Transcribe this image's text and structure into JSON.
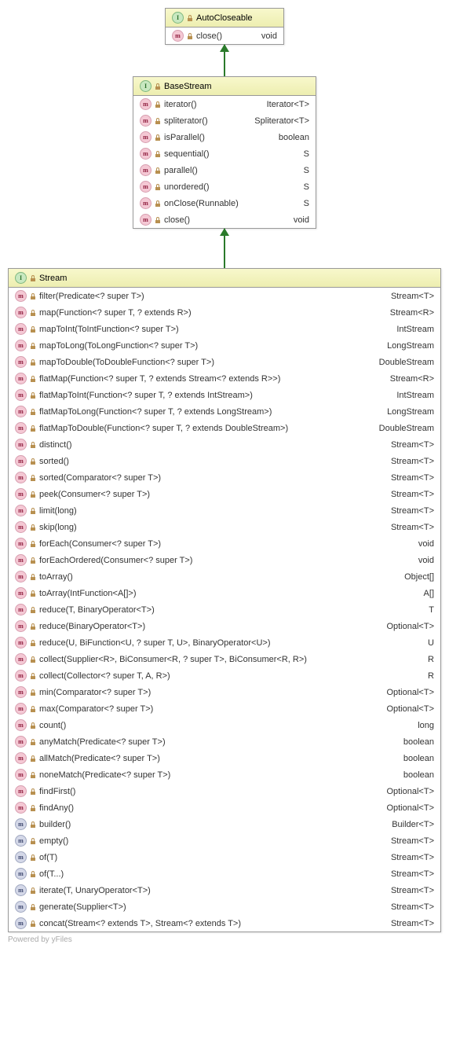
{
  "classes": {
    "autocloseable": {
      "name": "AutoCloseable",
      "members": [
        {
          "kind": "m",
          "name": "close()",
          "ret": "void"
        }
      ]
    },
    "basestream": {
      "name": "BaseStream",
      "members": [
        {
          "kind": "m",
          "name": "iterator()",
          "ret": "Iterator<T>"
        },
        {
          "kind": "m",
          "name": "spliterator()",
          "ret": "Spliterator<T>"
        },
        {
          "kind": "m",
          "name": "isParallel()",
          "ret": "boolean"
        },
        {
          "kind": "m",
          "name": "sequential()",
          "ret": "S"
        },
        {
          "kind": "m",
          "name": "parallel()",
          "ret": "S"
        },
        {
          "kind": "m",
          "name": "unordered()",
          "ret": "S"
        },
        {
          "kind": "m",
          "name": "onClose(Runnable)",
          "ret": "S"
        },
        {
          "kind": "m",
          "name": "close()",
          "ret": "void"
        }
      ]
    },
    "stream": {
      "name": "Stream",
      "members": [
        {
          "kind": "m",
          "name": "filter(Predicate<? super T>)",
          "ret": "Stream<T>"
        },
        {
          "kind": "m",
          "name": "map(Function<? super T, ? extends R>)",
          "ret": "Stream<R>"
        },
        {
          "kind": "m",
          "name": "mapToInt(ToIntFunction<? super T>)",
          "ret": "IntStream"
        },
        {
          "kind": "m",
          "name": "mapToLong(ToLongFunction<? super T>)",
          "ret": "LongStream"
        },
        {
          "kind": "m",
          "name": "mapToDouble(ToDoubleFunction<? super T>)",
          "ret": "DoubleStream"
        },
        {
          "kind": "m",
          "name": "flatMap(Function<? super T, ? extends Stream<? extends R>>)",
          "ret": "Stream<R>"
        },
        {
          "kind": "m",
          "name": "flatMapToInt(Function<? super T, ? extends IntStream>)",
          "ret": "IntStream"
        },
        {
          "kind": "m",
          "name": "flatMapToLong(Function<? super T, ? extends LongStream>)",
          "ret": "LongStream"
        },
        {
          "kind": "m",
          "name": "flatMapToDouble(Function<? super T, ? extends DoubleStream>)",
          "ret": "DoubleStream"
        },
        {
          "kind": "m",
          "name": "distinct()",
          "ret": "Stream<T>"
        },
        {
          "kind": "m",
          "name": "sorted()",
          "ret": "Stream<T>"
        },
        {
          "kind": "m",
          "name": "sorted(Comparator<? super T>)",
          "ret": "Stream<T>"
        },
        {
          "kind": "m",
          "name": "peek(Consumer<? super T>)",
          "ret": "Stream<T>"
        },
        {
          "kind": "m",
          "name": "limit(long)",
          "ret": "Stream<T>"
        },
        {
          "kind": "m",
          "name": "skip(long)",
          "ret": "Stream<T>"
        },
        {
          "kind": "m",
          "name": "forEach(Consumer<? super T>)",
          "ret": "void"
        },
        {
          "kind": "m",
          "name": "forEachOrdered(Consumer<? super T>)",
          "ret": "void"
        },
        {
          "kind": "m",
          "name": "toArray()",
          "ret": "Object[]"
        },
        {
          "kind": "m",
          "name": "toArray(IntFunction<A[]>)",
          "ret": "A[]"
        },
        {
          "kind": "m",
          "name": "reduce(T, BinaryOperator<T>)",
          "ret": "T"
        },
        {
          "kind": "m",
          "name": "reduce(BinaryOperator<T>)",
          "ret": "Optional<T>"
        },
        {
          "kind": "m",
          "name": "reduce(U, BiFunction<U, ? super T, U>, BinaryOperator<U>)",
          "ret": "U"
        },
        {
          "kind": "m",
          "name": "collect(Supplier<R>, BiConsumer<R, ? super T>, BiConsumer<R, R>)",
          "ret": "R"
        },
        {
          "kind": "m",
          "name": "collect(Collector<? super T, A, R>)",
          "ret": "R"
        },
        {
          "kind": "m",
          "name": "min(Comparator<? super T>)",
          "ret": "Optional<T>"
        },
        {
          "kind": "m",
          "name": "max(Comparator<? super T>)",
          "ret": "Optional<T>"
        },
        {
          "kind": "m",
          "name": "count()",
          "ret": "long"
        },
        {
          "kind": "m",
          "name": "anyMatch(Predicate<? super T>)",
          "ret": "boolean"
        },
        {
          "kind": "m",
          "name": "allMatch(Predicate<? super T>)",
          "ret": "boolean"
        },
        {
          "kind": "m",
          "name": "noneMatch(Predicate<? super T>)",
          "ret": "boolean"
        },
        {
          "kind": "m",
          "name": "findFirst()",
          "ret": "Optional<T>"
        },
        {
          "kind": "m",
          "name": "findAny()",
          "ret": "Optional<T>"
        },
        {
          "kind": "s",
          "name": "builder()",
          "ret": "Builder<T>"
        },
        {
          "kind": "s",
          "name": "empty()",
          "ret": "Stream<T>"
        },
        {
          "kind": "s",
          "name": "of(T)",
          "ret": "Stream<T>"
        },
        {
          "kind": "s",
          "name": "of(T...)",
          "ret": "Stream<T>"
        },
        {
          "kind": "s",
          "name": "iterate(T, UnaryOperator<T>)",
          "ret": "Stream<T>"
        },
        {
          "kind": "s",
          "name": "generate(Supplier<T>)",
          "ret": "Stream<T>"
        },
        {
          "kind": "s",
          "name": "concat(Stream<? extends T>, Stream<? extends T>)",
          "ret": "Stream<T>"
        }
      ]
    }
  },
  "footer": "Powered by yFiles"
}
